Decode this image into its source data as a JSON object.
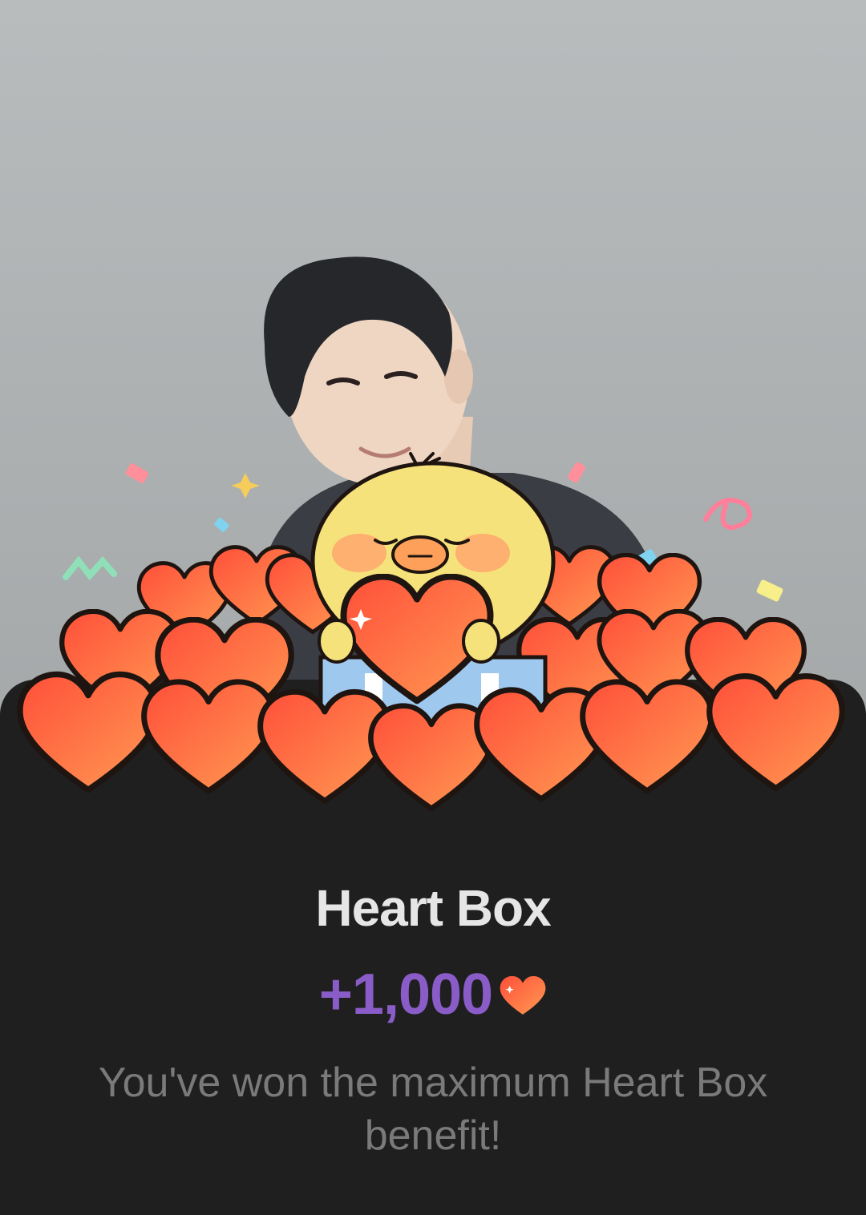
{
  "reward": {
    "title": "Heart Box",
    "amount": "+1,000",
    "currency_icon": "heart-icon",
    "message": "You've won the maximum Heart Box benefit!"
  },
  "colors": {
    "background": "#1f1f1f",
    "title": "#e6e6e6",
    "amount": "#8a5cc8",
    "message": "#7a7a7a",
    "heart": "#ff5a3c"
  }
}
